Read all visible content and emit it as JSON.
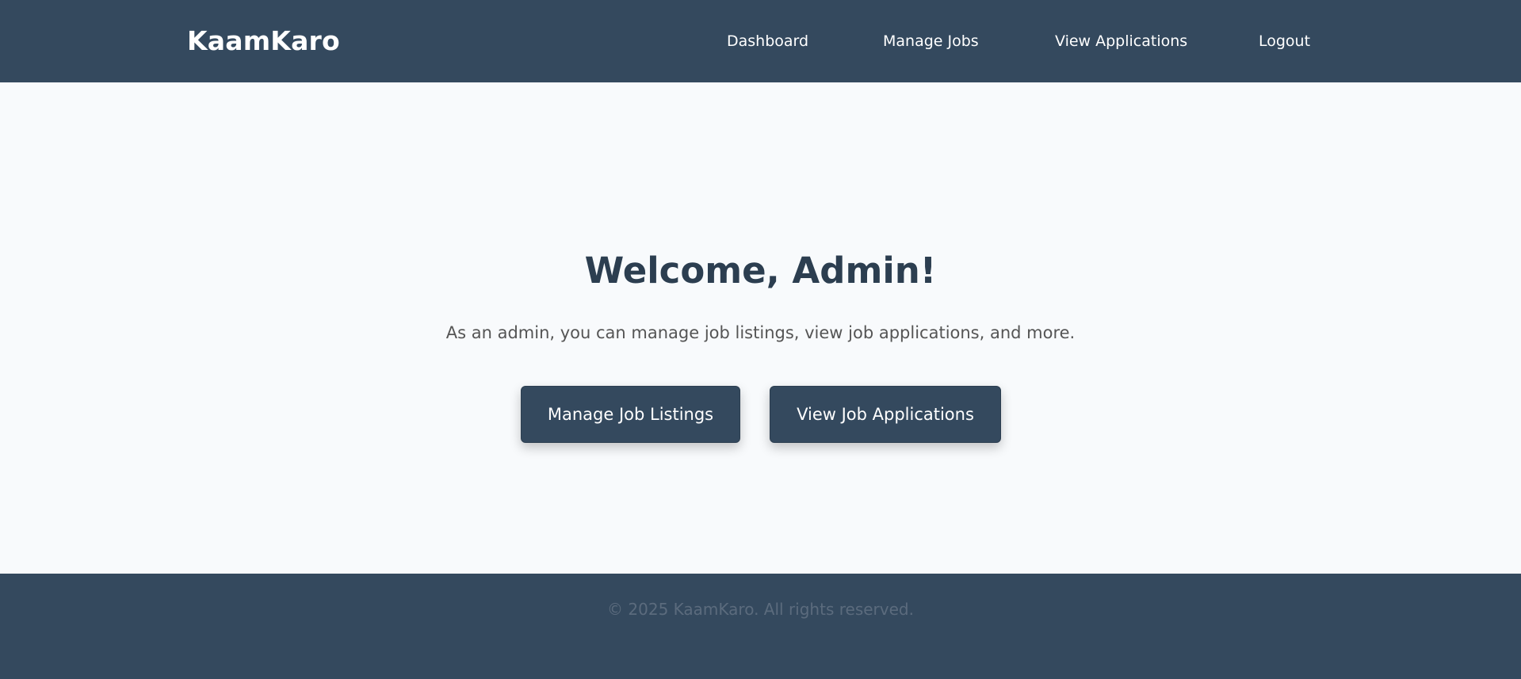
{
  "navbar": {
    "brand": "KaamKaro",
    "links": [
      {
        "label": "Dashboard"
      },
      {
        "label": "Manage Jobs"
      },
      {
        "label": "View Applications"
      },
      {
        "label": "Logout"
      }
    ]
  },
  "main": {
    "title": "Welcome, Admin!",
    "subtitle": "As an admin, you can manage job listings, view job applications, and more.",
    "buttons": [
      {
        "label": "Manage Job Listings"
      },
      {
        "label": "View Job Applications"
      }
    ]
  },
  "footer": {
    "text": "© 2025 KaamKaro. All rights reserved."
  },
  "colors": {
    "primary": "#34495e",
    "title": "#2c3e50",
    "background": "#f8fafc"
  }
}
